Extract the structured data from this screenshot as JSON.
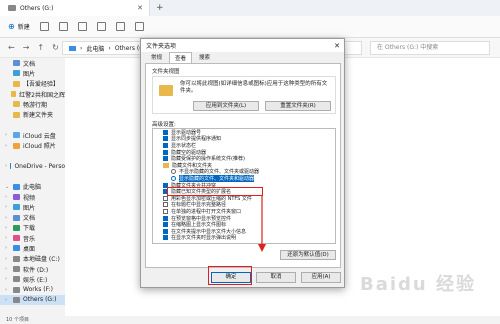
{
  "window": {
    "tab_title": "Others (G:)",
    "tab_close": "✕",
    "new_tab": "+",
    "status_text": "10 个项目"
  },
  "toolbar": {
    "new_label": "新建"
  },
  "address": {
    "crumbs": [
      "此电脑",
      "Others (G:)"
    ],
    "search_placeholder": "在 Others (G:) 中搜索"
  },
  "sidebar": {
    "items": [
      {
        "label": "文档",
        "color": "#5b8fd6",
        "caret": ""
      },
      {
        "label": "图片",
        "color": "#3aa0d8",
        "caret": ""
      },
      {
        "label": "【吾爱经验】",
        "color": "#e8b84a",
        "caret": ""
      },
      {
        "label": "红警2共和国之辉",
        "color": "#e8b84a",
        "caret": ""
      },
      {
        "label": "畅游行期",
        "color": "#e8b84a",
        "caret": ""
      },
      {
        "label": "新建文件夹",
        "color": "#e8b84a",
        "caret": ""
      },
      {
        "label": "",
        "color": "#f3f3f3",
        "caret": ""
      },
      {
        "label": "iCloud 云盘",
        "color": "#5aa7e8",
        "caret": "›"
      },
      {
        "label": "iCloud 照片",
        "color": "#f2a23c",
        "caret": "›"
      },
      {
        "label": "",
        "color": "#f3f3f3",
        "caret": ""
      },
      {
        "label": "OneDrive - Perso",
        "color": "#2b7cd3",
        "caret": "›"
      },
      {
        "label": "",
        "color": "#f3f3f3",
        "caret": ""
      },
      {
        "label": "此电脑",
        "color": "#3a8ee6",
        "caret": "⌄"
      },
      {
        "label": "视频",
        "color": "#8a5cd6",
        "caret": "›"
      },
      {
        "label": "图片",
        "color": "#3aa0d8",
        "caret": "›"
      },
      {
        "label": "文档",
        "color": "#5b8fd6",
        "caret": "›"
      },
      {
        "label": "下载",
        "color": "#2b9a5a",
        "caret": "›"
      },
      {
        "label": "音乐",
        "color": "#e0508a",
        "caret": "›"
      },
      {
        "label": "桌面",
        "color": "#3a8ee6",
        "caret": "›"
      },
      {
        "label": "本地磁盘 (C:)",
        "color": "#888888",
        "caret": "›"
      },
      {
        "label": "软件 (D:)",
        "color": "#888888",
        "caret": "›"
      },
      {
        "label": "娱乐 (E:)",
        "color": "#888888",
        "caret": "›"
      },
      {
        "label": "Works (F:)",
        "color": "#888888",
        "caret": "›"
      },
      {
        "label": "Others (G:)",
        "color": "#888888",
        "caret": "›",
        "selected": true
      }
    ]
  },
  "dialog": {
    "title": "文件夹选项",
    "close": "✕",
    "tabs": [
      "常规",
      "查看",
      "搜索"
    ],
    "active_tab": 1,
    "folder_views_title": "文件夹视图",
    "folder_views_text": "你可以将此视图(如详细信息或图标)应用于这种类型的所有文件夹。",
    "apply_btn": "应用到文件夹(L)",
    "reset_btn": "重置文件夹(R)",
    "advanced_label": "高级设置:",
    "advanced_items": [
      {
        "label": "显示驱动器号",
        "kind": "cb",
        "checked": true,
        "sub": false
      },
      {
        "label": "显示同步提供程序通知",
        "kind": "cb",
        "checked": true,
        "sub": false
      },
      {
        "label": "显示状态栏",
        "kind": "cb",
        "checked": true,
        "sub": false
      },
      {
        "label": "隐藏空的驱动器",
        "kind": "cb",
        "checked": true,
        "sub": false
      },
      {
        "label": "隐藏受保护的操作系统文件(推荐)",
        "kind": "cb",
        "checked": true,
        "sub": false
      },
      {
        "label": "隐藏文件和文件夹",
        "kind": "folder",
        "checked": false,
        "sub": false
      },
      {
        "label": "不显示隐藏的文件、文件夹或驱动器",
        "kind": "rb",
        "checked": false,
        "sub": true
      },
      {
        "label": "显示隐藏的文件、文件夹和驱动器",
        "kind": "rb",
        "checked": true,
        "sub": true,
        "highlight": true
      },
      {
        "label": "隐藏文件夹合并冲突",
        "kind": "cb",
        "checked": true,
        "sub": false
      },
      {
        "label": "隐藏已知文件类型的扩展名",
        "kind": "cb",
        "checked": true,
        "sub": false
      },
      {
        "label": "用彩色显示加密或压缩的 NTFS 文件",
        "kind": "cb",
        "checked": false,
        "sub": false
      },
      {
        "label": "在标题栏中显示完整路径",
        "kind": "cb",
        "checked": false,
        "sub": false
      },
      {
        "label": "在单独的进程中打开文件夹窗口",
        "kind": "cb",
        "checked": false,
        "sub": false
      },
      {
        "label": "在预览窗格中显示预览控件",
        "kind": "cb",
        "checked": true,
        "sub": false
      },
      {
        "label": "在缩略图上显示文件图标",
        "kind": "cb",
        "checked": true,
        "sub": false
      },
      {
        "label": "在文件夹提示中显示文件大小信息",
        "kind": "cb",
        "checked": true,
        "sub": false
      },
      {
        "label": "在显示文件夹时显示弹出说明",
        "kind": "cb",
        "checked": true,
        "sub": false
      }
    ],
    "restore_btn": "还原为默认值(D)",
    "ok_btn": "确定",
    "cancel_btn": "取消",
    "apply_bottom_btn": "应用(A)"
  },
  "watermark": "Baidu 经验",
  "colors": {
    "accent": "#0067c0",
    "annotation": "#e02020"
  }
}
